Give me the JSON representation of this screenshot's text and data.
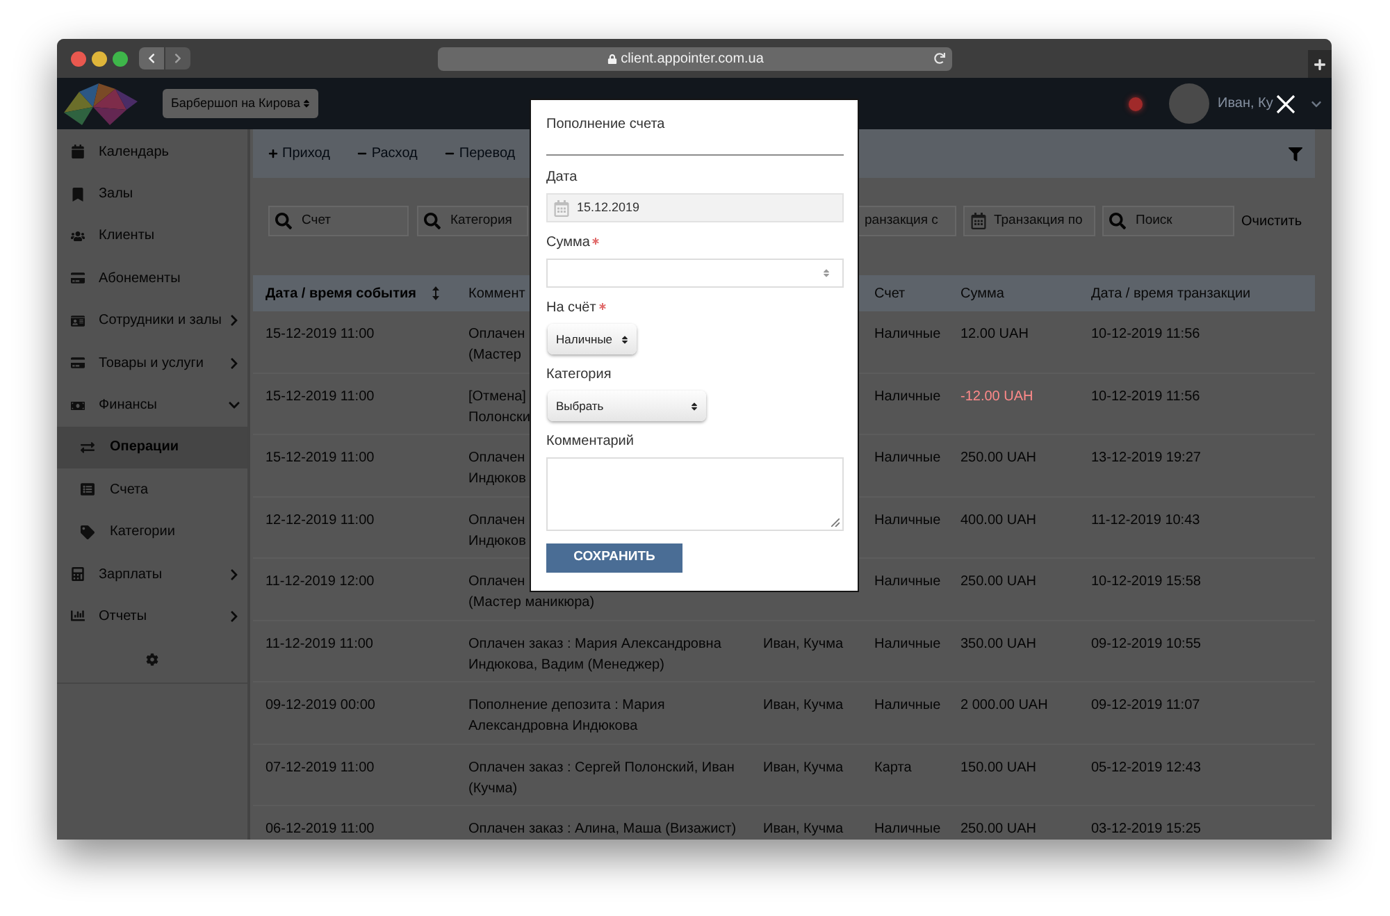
{
  "browser": {
    "url": "client.appointer.com.ua"
  },
  "header": {
    "branch": "Барбершоп на Кирова",
    "user_name": "Иван, Ку"
  },
  "sidebar": {
    "items": [
      {
        "label": "Календарь",
        "kind": "link",
        "selected": false
      },
      {
        "label": "Залы",
        "kind": "link",
        "selected": false
      },
      {
        "label": "Клиенты",
        "kind": "link",
        "selected": false
      },
      {
        "label": "Абонементы",
        "kind": "link",
        "selected": false
      },
      {
        "label": "Сотрудники и залы",
        "kind": "group",
        "expanded": false,
        "selected": false
      },
      {
        "label": "Товары и услуги",
        "kind": "group",
        "expanded": false,
        "selected": false
      },
      {
        "label": "Финансы",
        "kind": "group",
        "expanded": true,
        "selected": false,
        "children": [
          {
            "label": "Операции",
            "selected": true
          },
          {
            "label": "Счета",
            "selected": false
          },
          {
            "label": "Категории",
            "selected": false
          }
        ]
      },
      {
        "label": "Зарплаты",
        "kind": "group",
        "expanded": false,
        "selected": false
      },
      {
        "label": "Отчеты",
        "kind": "group",
        "expanded": false,
        "selected": false
      }
    ]
  },
  "toolbar": {
    "actions": [
      {
        "kind": "plus",
        "label": "Приход"
      },
      {
        "kind": "minus",
        "label": "Расход"
      },
      {
        "kind": "minus",
        "label": "Перевод"
      }
    ]
  },
  "filters": {
    "fields": [
      {
        "kind": "search",
        "placeholder": "Счет"
      },
      {
        "kind": "search",
        "placeholder": "Категория"
      },
      {
        "kind": "plain",
        "placeholder": "ранзакция с"
      },
      {
        "kind": "date",
        "placeholder": "Транзакция по"
      },
      {
        "kind": "search",
        "placeholder": "Поиск"
      }
    ],
    "clear": "Очистить"
  },
  "table": {
    "columns": [
      {
        "label": "Дата / время события",
        "sorted": true
      },
      {
        "label": "Коммент",
        "sorted": false
      },
      {
        "label": "Счет",
        "sorted": false
      },
      {
        "label": "Сумма",
        "sorted": false
      },
      {
        "label": "Дата / время транзакции",
        "sorted": false
      }
    ],
    "rows": [
      {
        "event_time": "15-12-2019 11:00",
        "comment": [
          "Оплачен",
          "(Мастер"
        ],
        "account": "Наличные",
        "amount": "12.00 UAH",
        "negative": false,
        "transaction_time": "10-12-2019 11:56"
      },
      {
        "event_time": "15-12-2019 11:00",
        "comment": [
          "[Отмена]",
          "Полонски"
        ],
        "account": "Наличные",
        "amount": "-12.00 UAH",
        "negative": true,
        "transaction_time": "10-12-2019 11:56"
      },
      {
        "event_time": "15-12-2019 11:00",
        "comment": [
          "Оплачен",
          "Индюков"
        ],
        "account": "Наличные",
        "amount": "250.00 UAH",
        "negative": false,
        "transaction_time": "13-12-2019 19:27"
      },
      {
        "event_time": "12-12-2019 11:00",
        "comment": [
          "Оплачен",
          "Индюков"
        ],
        "account": "Наличные",
        "amount": "400.00 UAH",
        "negative": false,
        "transaction_time": "11-12-2019 10:43"
      },
      {
        "event_time": "11-12-2019 12:00",
        "comment": [
          "Оплачен",
          "(Мастер маникюра)"
        ],
        "account": "Наличные",
        "amount": "250.00 UAH",
        "negative": false,
        "transaction_time": "10-12-2019 15:58"
      },
      {
        "event_time": "11-12-2019 11:00",
        "comment": [
          "Оплачен заказ : Мария Александровна",
          "Индюкова, Вадим (Менеджер)"
        ],
        "employee": "Иван, Кучма",
        "account": "Наличные",
        "amount": "350.00 UAH",
        "negative": false,
        "transaction_time": "09-12-2019 10:55"
      },
      {
        "event_time": "09-12-2019 00:00",
        "comment": [
          "Пополнение депозита : Мария",
          "Александровна Индюкова"
        ],
        "employee": "Иван, Кучма",
        "account": "Наличные",
        "amount": "2 000.00 UAH",
        "negative": false,
        "transaction_time": "09-12-2019 11:07"
      },
      {
        "event_time": "07-12-2019 11:00",
        "comment": [
          "Оплачен заказ : Сергей Полонский, Иван",
          "(Кучма)"
        ],
        "employee": "Иван, Кучма",
        "account": "Карта",
        "amount": "150.00 UAH",
        "negative": false,
        "transaction_time": "05-12-2019 12:43"
      },
      {
        "event_time": "06-12-2019 11:00",
        "comment": [
          "Оплачен заказ : Алина, Маша (Визажист)"
        ],
        "employee": "Иван, Кучма",
        "account": "Наличные",
        "amount": "250.00 UAH",
        "negative": false,
        "transaction_time": "03-12-2019 15:25"
      }
    ]
  },
  "modal": {
    "title": "Пополнение счета",
    "fields": [
      {
        "kind": "date",
        "label": "Дата",
        "value": "15.12.2019",
        "required": false
      },
      {
        "kind": "number",
        "label": "Сумма",
        "required": true
      },
      {
        "kind": "select",
        "label": "На счёт",
        "value": "Наличные",
        "required": true
      },
      {
        "kind": "select",
        "label": "Категория",
        "value": "Выбрать",
        "required": false
      },
      {
        "kind": "textarea",
        "label": "Комментарий",
        "required": false
      }
    ],
    "submit": "СОХРАНИТЬ"
  }
}
